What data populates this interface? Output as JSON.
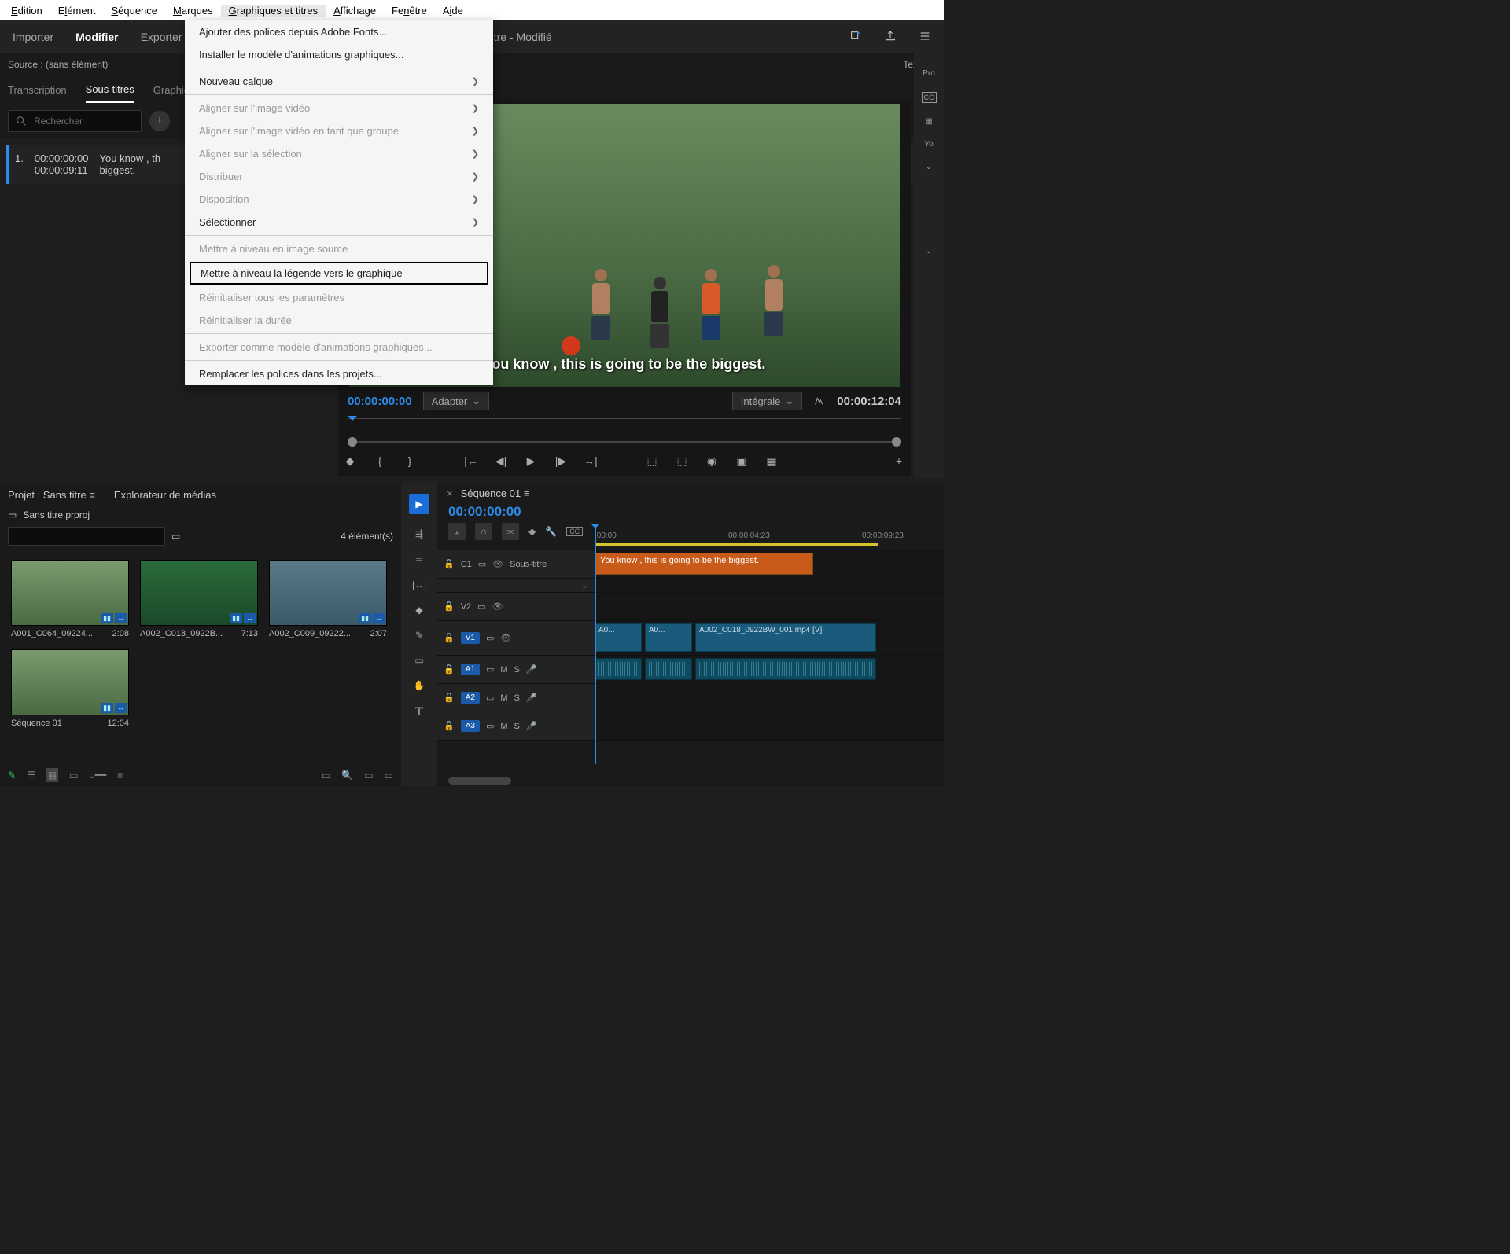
{
  "menubar": [
    "Edition",
    "Elément",
    "Séquence",
    "Marques",
    "Graphiques et titres",
    "Affichage",
    "Fenêtre",
    "Aide"
  ],
  "workspaces": {
    "items": [
      "Importer",
      "Modifier",
      "Exporter"
    ],
    "title": "s titre - Modifié"
  },
  "source_header": {
    "label": "Source : (sans élément)",
    "texte": "Texte"
  },
  "left_tabs": [
    "Transcription",
    "Sous-titres",
    "Graphiq"
  ],
  "search_placeholder": "Rechercher",
  "caption": {
    "num": "1.",
    "t_in": "00:00:00:00",
    "t_out": "00:00:09:11",
    "text_a": "You know , th",
    "text_b": "biggest."
  },
  "dropdown": [
    {
      "label": "Ajouter des polices depuis Adobe Fonts...",
      "type": "item"
    },
    {
      "label": "Installer le modèle d'animations graphiques...",
      "type": "item"
    },
    {
      "type": "sep"
    },
    {
      "label": "Nouveau calque",
      "type": "sub"
    },
    {
      "type": "sep"
    },
    {
      "label": "Aligner sur l'image vidéo",
      "type": "sub",
      "disabled": true
    },
    {
      "label": "Aligner sur l'image vidéo en tant que groupe",
      "type": "sub",
      "disabled": true
    },
    {
      "label": "Aligner sur la sélection",
      "type": "sub",
      "disabled": true
    },
    {
      "label": "Distribuer",
      "type": "sub",
      "disabled": true
    },
    {
      "label": "Disposition",
      "type": "sub",
      "disabled": true
    },
    {
      "label": "Sélectionner",
      "type": "sub"
    },
    {
      "type": "sep"
    },
    {
      "label": "Mettre à niveau en image source",
      "type": "item",
      "disabled": true
    },
    {
      "label": "Mettre à niveau la légende vers le graphique",
      "type": "item",
      "highlight": true
    },
    {
      "label": "Réinitialiser tous les paramètres",
      "type": "item",
      "disabled": true
    },
    {
      "label": "Réinitialiser la durée",
      "type": "item",
      "disabled": true
    },
    {
      "type": "sep"
    },
    {
      "label": "Exporter comme modèle d'animations graphiques...",
      "type": "item",
      "disabled": true
    },
    {
      "type": "sep"
    },
    {
      "label": "Remplacer les polices dans les projets...",
      "type": "item"
    }
  ],
  "subtitle_text": "You know , this is going to be the biggest.",
  "monitor": {
    "tc_in": "00:00:00:00",
    "fit": "Adapter",
    "scale": "Intégrale",
    "tc_out": "00:00:12:04"
  },
  "right_rail": [
    "Pro",
    "CC",
    "☰",
    "Yo",
    "⌄",
    "⌄"
  ],
  "project": {
    "tabs": [
      "Projet : Sans titre",
      "Explorateur de médias"
    ],
    "file": "Sans titre.prproj",
    "count": "4 élément(s)",
    "clips": [
      {
        "name": "A001_C064_09224...",
        "dur": "2:08"
      },
      {
        "name": "A002_C018_0922B...",
        "dur": "7:13"
      },
      {
        "name": "A002_C009_09222...",
        "dur": "2:07"
      },
      {
        "name": "Séquence 01",
        "dur": "12:04"
      }
    ]
  },
  "timeline": {
    "seq": "Séquence 01",
    "tc": "00:00:00:00",
    "ruler": [
      ";00:00",
      "00:00:04:23",
      "00:00:09:23"
    ],
    "caption_track": "Sous-titre",
    "caption_clip": "You know , this is going to be the biggest.",
    "tracks": [
      "V2",
      "V1",
      "A1",
      "A2",
      "A3"
    ],
    "v1_clips": [
      "A0...",
      "A0...",
      "A002_C018_0922BW_001.mp4 [V]"
    ],
    "c_label": "C1"
  }
}
